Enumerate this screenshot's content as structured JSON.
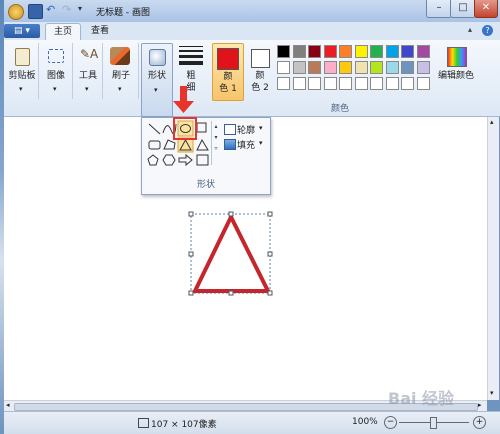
{
  "window": {
    "title": "无标题 - 画图"
  },
  "tabs": {
    "file_label": "",
    "home": "主页",
    "view": "查看"
  },
  "ribbon": {
    "clipboard": "剪贴板",
    "image": "图像",
    "tools": "工具",
    "brushes": "刷子",
    "shapes": "形状",
    "size_line1": "粗",
    "size_line2": "细",
    "color1_line1": "颜",
    "color1_line2": "色 1",
    "color2_line1": "颜",
    "color2_line2": "色 2",
    "colors_group": "颜色",
    "edit_colors": "编辑颜色"
  },
  "shapes_popup": {
    "outline": "轮廓",
    "fill": "填充",
    "group_label": "形状"
  },
  "colors": {
    "color1": "#e0121a",
    "color2": "#ffffff",
    "palette_row1": [
      "#000000",
      "#7f7f7f",
      "#880015",
      "#ed1c24",
      "#ff7f27",
      "#fff200",
      "#22b14c",
      "#00a2e8",
      "#3f48cc",
      "#a349a4"
    ],
    "palette_row2": [
      "#ffffff",
      "#c3c3c3",
      "#b97a57",
      "#ffaec9",
      "#ffc90e",
      "#efe4b0",
      "#b5e61d",
      "#99d9ea",
      "#7092be",
      "#c8bfe7"
    ],
    "accent": "#e8342a"
  },
  "statusbar": {
    "size": "107 × 107像素",
    "zoom": "100%"
  },
  "watermark": {
    "text": "Bai 经验"
  }
}
